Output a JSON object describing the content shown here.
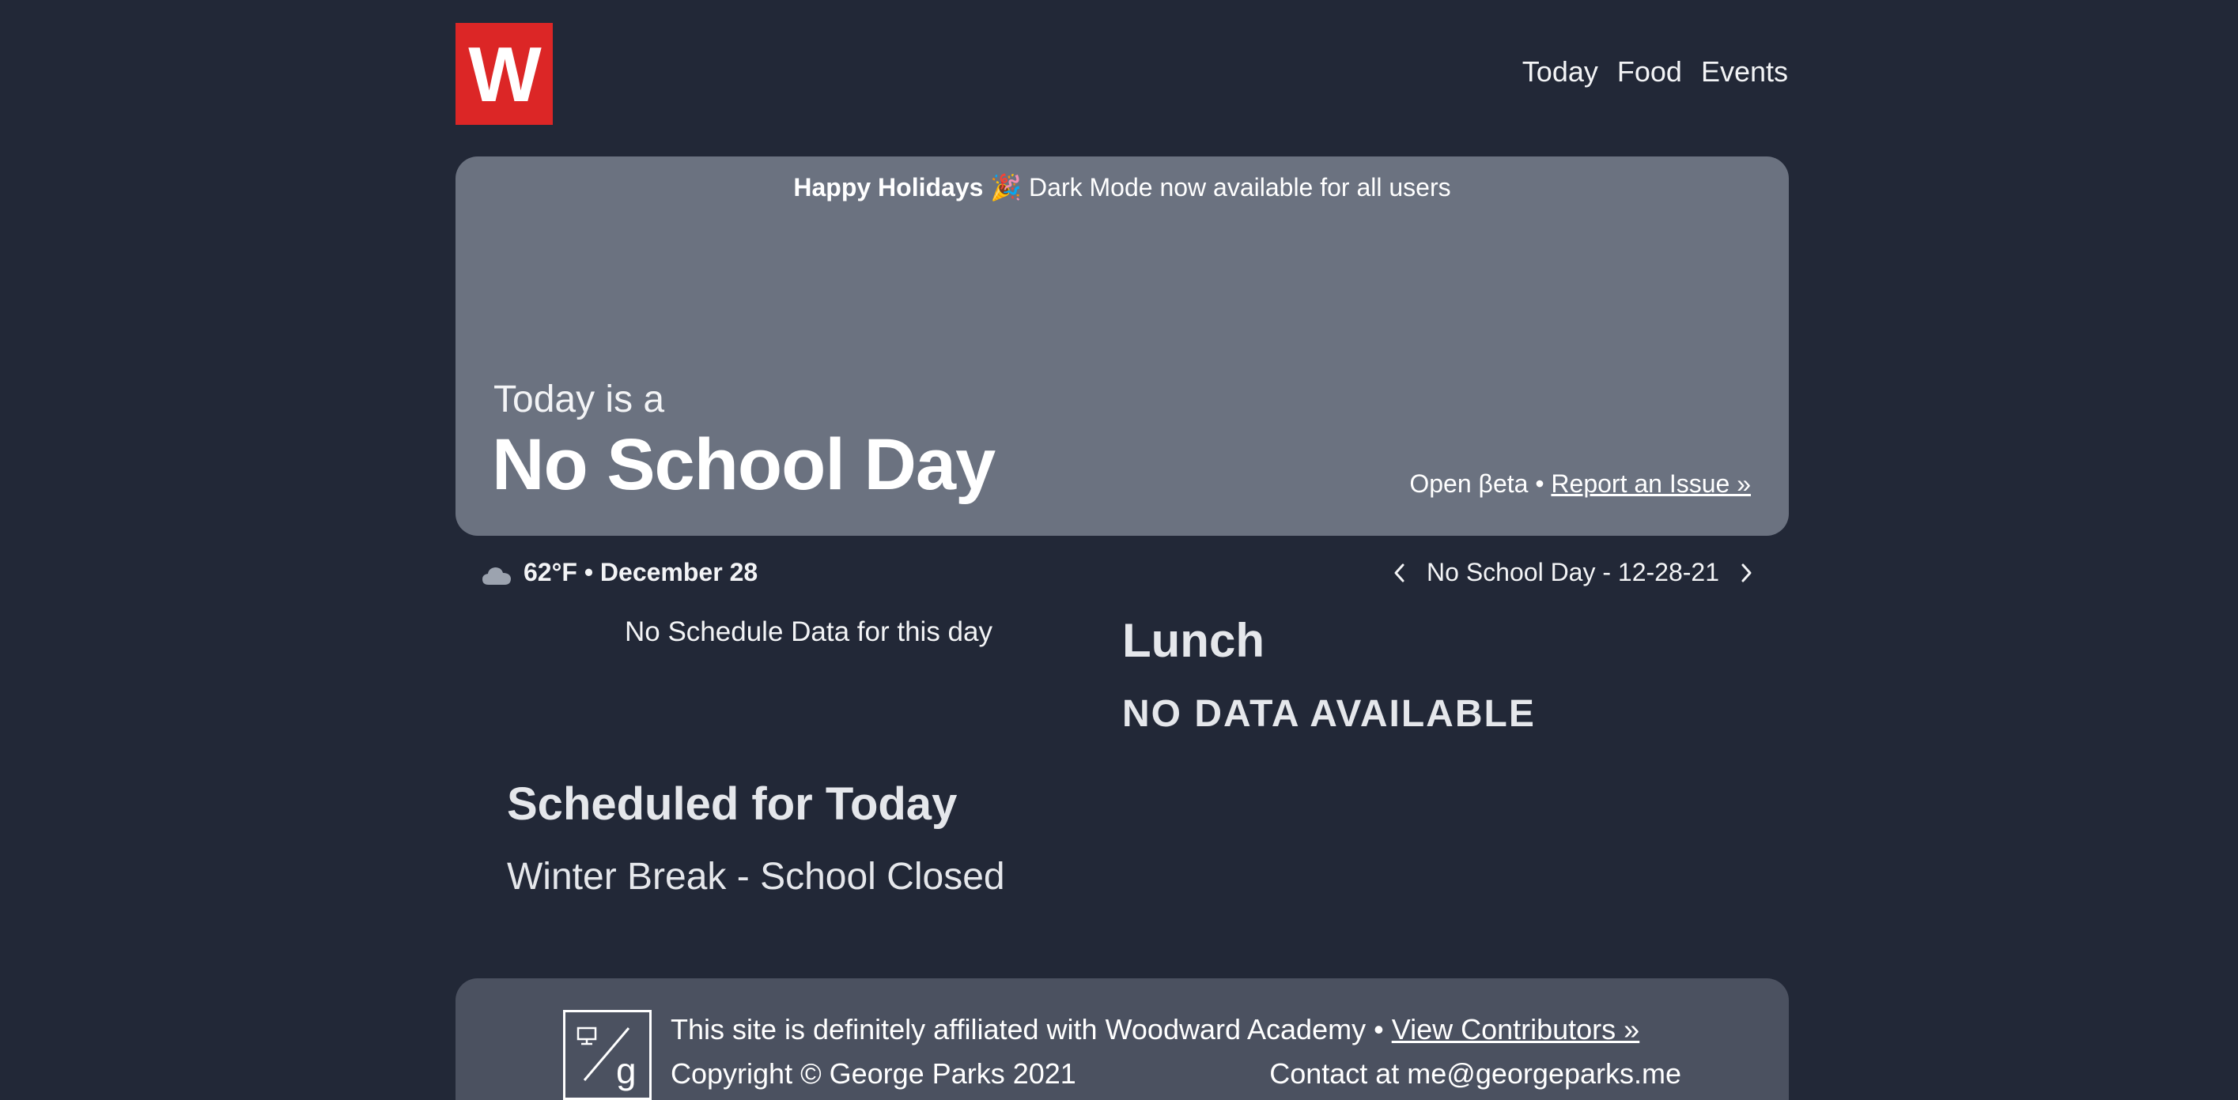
{
  "header": {
    "logo_letter": "W",
    "nav": [
      "Today",
      "Food",
      "Events"
    ]
  },
  "hero": {
    "announcement_bold": "Happy Holidays",
    "announcement_emoji": "🎉",
    "announcement_text": "Dark Mode now available for all users",
    "today_label": "Today is a",
    "day_type": "No School Day",
    "beta_label": "Open βeta •",
    "report_link": "Report an Issue »"
  },
  "info": {
    "weather_icon": "cloud-icon",
    "weather_text": "62°F • December 28",
    "day_nav_label": "No School Day - 12-28-21"
  },
  "schedule": {
    "empty_text": "No Schedule Data for this day"
  },
  "lunch": {
    "title": "Lunch",
    "status": "NO DATA AVAILABLE"
  },
  "today_events": {
    "title": "Scheduled for Today",
    "items": [
      "Winter Break - School Closed"
    ]
  },
  "footer": {
    "logo_icon": "george-parks-logo-icon",
    "line1_text": "This site is definitely affiliated with Woodward Academy •",
    "contributors_link": "View Contributors »",
    "copyright": "Copyright © George Parks 2021",
    "contact": "Contact at me@georgeparks.me"
  },
  "colors": {
    "background": "#222837",
    "hero": "#6b7280",
    "footer": "#4b5160",
    "logo": "#dc2626"
  }
}
